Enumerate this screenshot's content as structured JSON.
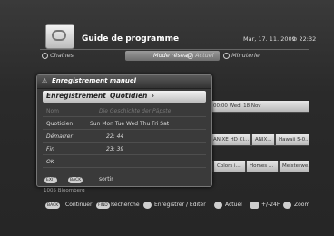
{
  "header": {
    "title": "Guide de programme",
    "date": "Mar, 17. 11. 2009",
    "time": "22:32"
  },
  "modes": {
    "chaines": "Chaines",
    "mode_reseau": "Mode réseau",
    "actuel": "Actuel",
    "minuterie": "Minuterie"
  },
  "grid": {
    "row1_cell": "00:00 Wed. 18 Nov",
    "row2_cells": [
      "ANIXE HD Cl...",
      "ANIX...",
      "Hawaii 5-0..."
    ],
    "row3_cells": [
      "Colors i...",
      "Homes ...",
      "Meisterwe..."
    ],
    "channel_label": "1005 Bloomberg"
  },
  "dialog": {
    "title": "Enregistrement manuel",
    "type": "Enregistrement",
    "mode": "Quotidien",
    "nom_label": "Nom",
    "nom_value": "Die Geschichte der Päpste",
    "quotidien_label": "Quotidien",
    "days": "Sun Mon Tue Wed Thu Fri Sat",
    "demarrer_label": "Démarrer",
    "demarrer_value": "22: 44",
    "fin_label": "Fin",
    "fin_value": "23: 39",
    "ok_label": "OK",
    "exit_key1": "EXIT",
    "exit_key2": "BACK",
    "exit_label": "sortir"
  },
  "footer": {
    "back_key": "BACK",
    "continuer": "Continuer",
    "find_key": "FIND",
    "recherche": "Recherche",
    "enregistrer": "Enregistrer / Editer",
    "actuel": "Actuel",
    "plus_minus": "+/-24H",
    "zoom": "Zoom"
  }
}
